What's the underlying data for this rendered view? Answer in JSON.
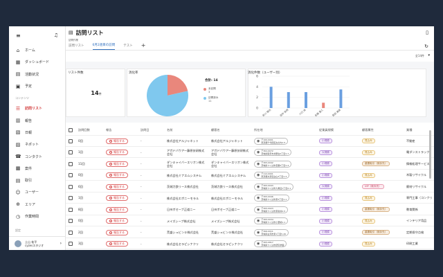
{
  "sidebar": {
    "items": [
      {
        "label": "ホーム",
        "icon": "home-icon",
        "glyph": "⌂"
      },
      {
        "label": "ダッシュボード",
        "icon": "dashboard-icon",
        "glyph": "▦"
      },
      {
        "label": "活動状況",
        "icon": "activity-icon",
        "glyph": "▤"
      },
      {
        "label": "予定",
        "icon": "calendar-icon",
        "glyph": "▣"
      }
    ],
    "section_label": "コンテンツ",
    "content_items": [
      {
        "label": "訪問リスト",
        "icon": "visit-list-icon",
        "glyph": "☰",
        "active": true
      },
      {
        "label": "報告",
        "icon": "report-icon",
        "glyph": "▥"
      },
      {
        "label": "日報",
        "icon": "daily-report-icon",
        "glyph": "▧"
      },
      {
        "label": "ネポット",
        "icon": "folder-icon",
        "glyph": "▨"
      },
      {
        "label": "コンタクト",
        "icon": "contact-icon",
        "glyph": "☎"
      },
      {
        "label": "案件",
        "icon": "deal-icon",
        "glyph": "▩"
      },
      {
        "label": "取引",
        "icon": "transaction-icon",
        "glyph": "▤"
      },
      {
        "label": "ユーザー",
        "icon": "user-icon",
        "glyph": "☺"
      },
      {
        "label": "エリア",
        "icon": "area-icon",
        "glyph": "⊕"
      },
      {
        "label": "作業時間",
        "icon": "clock-icon",
        "glyph": "◷"
      }
    ],
    "bottom_section_label": "設定",
    "user": {
      "name": "土山 祐平",
      "org": "cyzesスタジオ"
    }
  },
  "header": {
    "title": "訪問リスト"
  },
  "tabs_label": "訪問作業",
  "tabs": [
    {
      "label": "訪問リスト",
      "active": false
    },
    {
      "label": "6月2週目の訪問",
      "active": true
    },
    {
      "label": "テスト",
      "active": false
    }
  ],
  "tab_add": "+",
  "count_text": "全14件",
  "cards": {
    "list_count_label": "リスト件数",
    "list_count_value": "14",
    "list_count_unit": "件",
    "rate_label": "消化率",
    "total_text": "合計: 14",
    "bar_label": "消化件数（ユーザー別）"
  },
  "chart_data": [
    {
      "type": "pie",
      "title": "消化率",
      "total": 14,
      "series": [
        {
          "name": "未訪問",
          "value": 3,
          "color": "#e9877c"
        },
        {
          "name": "訪問済み",
          "value": 11,
          "color": "#7fc8ee"
        }
      ]
    },
    {
      "type": "bar",
      "title": "消化件数（ユーザー別）",
      "categories": [
        "新川 慎也",
        "田中 俊明",
        "川口 由",
        "佐藤 直人",
        "島田 美保"
      ],
      "values": [
        4,
        3,
        3,
        1,
        3.5
      ],
      "colors": [
        "#6a9fe0",
        "#6a9fe0",
        "#6a9fe0",
        "#e9877c",
        "#6a9fe0"
      ],
      "ylim": [
        0,
        6
      ],
      "yticks": [
        "0",
        "2",
        "4",
        "6"
      ]
    }
  ],
  "table": {
    "headers": [
      "訪問回数",
      "報告",
      "訪問日",
      "名前",
      "顧客名",
      "所在地",
      "従業員規模",
      "顧客属性",
      "業種"
    ],
    "rows": [
      {
        "visits": "0回",
        "status": "報告する",
        "date": "-",
        "name": "株式会社アルジャネット",
        "customer": "株式会社アルジャネット",
        "zip": "〒100-0001",
        "addr": "東京都千代田区丸の内1-5",
        "size": "小規模",
        "attr": "見込み",
        "attr_class": "tag-b",
        "industry": "不動産"
      },
      {
        "visits": "1回",
        "status": "報告する",
        "date": "-",
        "name": "アガドバウアー藤原技研株式会社",
        "customer": "アガドバウアー藤原技研株式会社",
        "zip": "〒302-0072",
        "addr": "茨城県取手市井野台2丁目1-7",
        "size": "大規模",
        "attr": "見込み",
        "attr_class": "tag-b",
        "industry": "電ダンストラック"
      },
      {
        "visits": "11回",
        "status": "報告する",
        "date": "-",
        "name": "ダンキャイバーエリオン株式会社",
        "customer": "ダンキャイバーエリオン株式会社",
        "zip": "〒305-0042",
        "addr": "茨城県つくば市吾妻2丁目1-4",
        "size": "小規模",
        "attr": "重要取引（既存先）",
        "attr_class": "tag-d",
        "industry": "情報処理サービス"
      },
      {
        "visits": "0回",
        "status": "報告する",
        "date": "-",
        "name": "株式会社ミナエムシステム",
        "customer": "株式会社ミナエムシステム",
        "zip": "〒112-0001",
        "addr": "東京都文京区白山5丁目1-3",
        "size": "小規模",
        "attr": "見込み",
        "attr_class": "tag-b",
        "industry": "木製リサイクル"
      },
      {
        "visits": "6回",
        "status": "報告する",
        "date": "-",
        "name": "茨城力鉄リース株式会社",
        "customer": "茨城力鉄リース株式会社",
        "zip": "〒305-0043",
        "addr": "茨城県つくば市大角豆1丁目2-1",
        "size": "大規模",
        "attr": "VIP（既存先）",
        "attr_class": "tag-c",
        "industry": "廃材リサイクル"
      },
      {
        "visits": "1回",
        "status": "報告する",
        "date": "-",
        "name": "株式会社エボニーモラル",
        "customer": "株式会社エボニーモラル",
        "zip": "〒305-0046",
        "addr": "茨城県つくば市東2丁目1-1",
        "size": "小規模",
        "attr": "見込み",
        "attr_class": "tag-b",
        "industry": "専門工事（コンクリート）"
      },
      {
        "visits": "8回",
        "status": "報告する",
        "date": "-",
        "name": "日州ボセーブ正道ニー",
        "customer": "日州ボセーブ正道ニー",
        "zip": "〒305-0023",
        "addr": "茨城県つくば市東新井2-5",
        "size": "小規模",
        "attr": "重要取引（既存先）",
        "attr_class": "tag-d",
        "industry": "教育関係"
      },
      {
        "visits": "0回",
        "status": "報告する",
        "date": "-",
        "name": "メイズシープ株式会社",
        "customer": "メイズシープ株式会社",
        "zip": "〒305-0034",
        "addr": "茨城県つくば市小野崎1-1",
        "size": "小規模",
        "attr": "見込み",
        "attr_class": "tag-b",
        "industry": "インテリア用品"
      },
      {
        "visits": "2回",
        "status": "報告する",
        "date": "-",
        "name": "荒盛シュビンキ株式会社",
        "customer": "荒盛シュビンキ株式会社",
        "zip": "〒306-0011",
        "addr": "茨城県古河市東1丁目5-26",
        "size": "小規模",
        "attr": "重要取引（既存先）",
        "attr_class": "tag-d",
        "industry": "定期保守点検"
      },
      {
        "visits": "3回",
        "status": "報告する",
        "date": "-",
        "name": "株式会社セラピシナクリ",
        "customer": "株式会社セラピシナクリ",
        "zip": "〒305-0817",
        "addr": "茨城県つくば市研究学園",
        "size": "小規模",
        "attr": "見込み",
        "attr_class": "tag-b",
        "industry": "印刷工業"
      }
    ]
  }
}
